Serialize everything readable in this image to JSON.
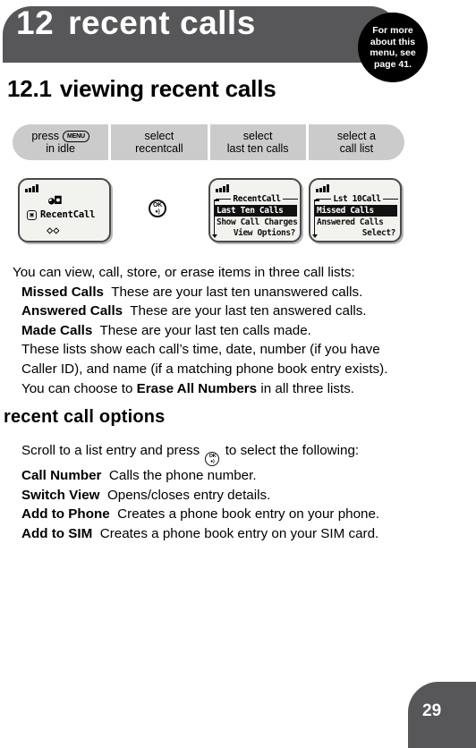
{
  "chapter": {
    "number": "12",
    "title": "recent calls",
    "more_info_lines": [
      "For more",
      "about this",
      "menu, see",
      "page 41."
    ]
  },
  "section": {
    "number": "12.1",
    "title": "viewing recent calls"
  },
  "steps": [
    {
      "line1_prefix": "press",
      "key_icon_label": "MENU",
      "line2": "in idle"
    },
    {
      "line1_prefix": "select",
      "key_icon_label": "",
      "line2": "recentcall"
    },
    {
      "line1_prefix": "select",
      "key_icon_label": "",
      "line2": "last ten calls"
    },
    {
      "line1_prefix": "select a",
      "key_icon_label": "",
      "line2": "call list"
    }
  ],
  "screens": {
    "idle": {
      "status_icon": "signal-bars-icon",
      "top_icon": "ringer-icon",
      "menu_icon": "menu-box-icon",
      "label": "RecentCall",
      "bottom_icon": "messages-icon"
    },
    "recentcall": {
      "title": "RecentCall",
      "selected_item": "Last Ten Calls",
      "second_item": "Show Call Charges",
      "softkey": "View Options?"
    },
    "last10": {
      "title": "Lst 10Call",
      "selected_item": "Missed Calls",
      "second_item": "Answered Calls",
      "softkey": "Select?"
    },
    "ok_key": {
      "label": "OK",
      "sub": "glyph"
    }
  },
  "body": {
    "intro": "You can view, call, store, or erase items in three call lists:",
    "list": [
      {
        "term": "Missed Calls",
        "desc": "These are your last ten unanswered calls."
      },
      {
        "term": "Answered Calls",
        "desc": "These are your last ten answered calls."
      },
      {
        "term": "Made Calls",
        "desc": "These are your last ten calls made."
      }
    ],
    "note_line_1": "These lists show each call’s time, date, number (if you have",
    "note_line_2": "Caller ID), and name (if a matching phone book entry exists).",
    "erase_prefix": "You can choose to ",
    "erase_term": "Erase All Numbers",
    "erase_suffix": " in all three lists."
  },
  "subsection": {
    "title": "recent call options",
    "intro_prefix": "Scroll to a list entry and press",
    "intro_suffix": "to select the following:",
    "options": [
      {
        "term": "Call Number",
        "desc": "Calls the phone number."
      },
      {
        "term": "Switch View",
        "desc": "Opens/closes entry details."
      },
      {
        "term": "Add to Phone",
        "desc": "Creates a phone book entry on your phone."
      },
      {
        "term": "Add to SIM",
        "desc": "Creates a phone book entry on your SIM card."
      }
    ]
  },
  "footer": {
    "page_number": "29"
  },
  "colors": {
    "header_gray": "#57575a",
    "step_gray": "#cbcbcb",
    "bubble_black": "#000000",
    "screen_bg": "#f2f2ef"
  }
}
